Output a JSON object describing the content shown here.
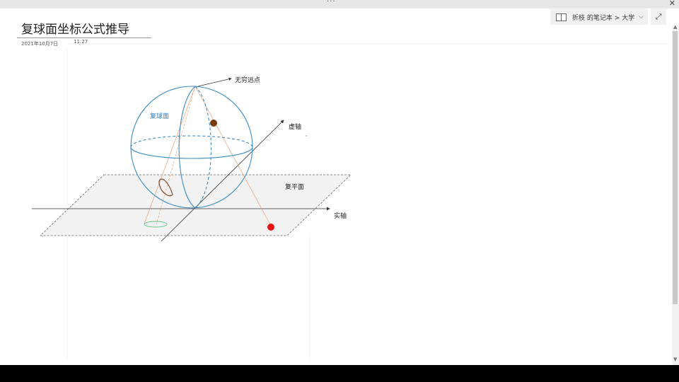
{
  "window": {
    "more_glyph": "···",
    "close_glyph": "✕"
  },
  "nav": {
    "breadcrumb": "折枝 的笔记本 > 大学",
    "chevron_glyph": "⌵",
    "expand_glyph": "⤢"
  },
  "note": {
    "title": "复球面坐标公式推导",
    "date": "2021年10月7日",
    "time": "11:27"
  },
  "diagram": {
    "label_infinity": "无穷远点",
    "label_sphere": "复球面",
    "label_imag_axis": "虚轴",
    "label_plane": "复平面",
    "label_real_axis": "实轴",
    "colors": {
      "sphere": "#3a8cc4",
      "plane_fill": "#f2f2f2",
      "plane_edge": "#666666",
      "proj_line": "#e8a07a",
      "point_sphere": "#7a3b12",
      "point_plane": "#e61414",
      "curve_sphere": "#8a4a2a",
      "curve_plane": "#5fc48c"
    }
  },
  "scrollbar": {
    "up_glyph": "▲",
    "down_glyph": "▼"
  }
}
